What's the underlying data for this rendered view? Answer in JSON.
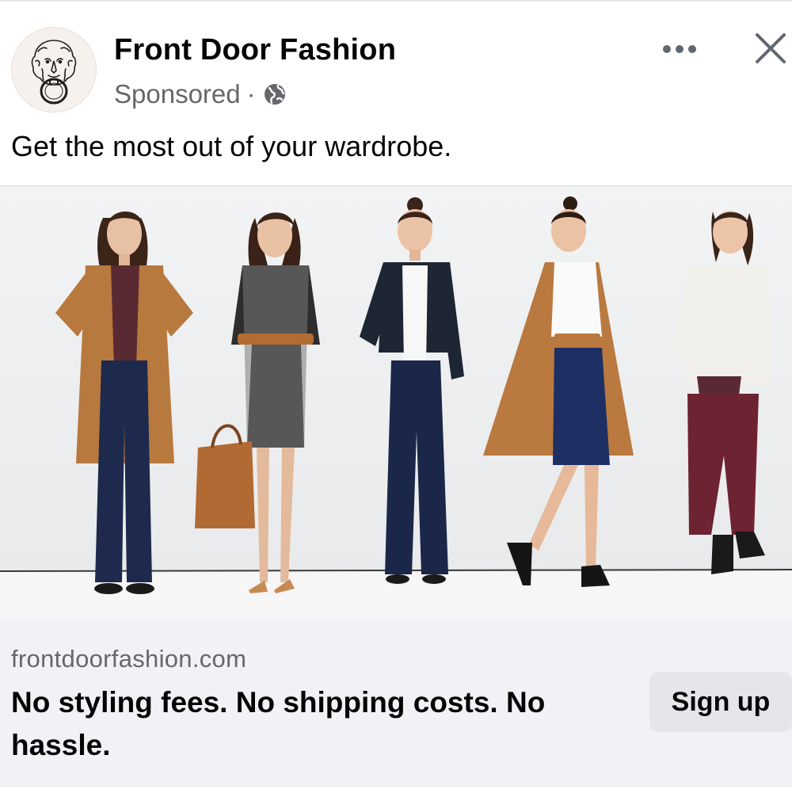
{
  "post": {
    "page_name": "Front Door Fashion",
    "sponsored_label": "Sponsored",
    "separator": "·",
    "audience_icon": "globe-icon",
    "more_icon": "more-horizontal-icon",
    "close_icon": "close-icon",
    "text": "Get the most out of your wardrobe."
  },
  "media": {
    "description_icon": "lion-door-knocker-logo",
    "models": [
      {
        "outfit": "camel suede duster, plaid shirt, flare jeans"
      },
      {
        "outfit": "geometric print wrap dress, belt, tote bag"
      },
      {
        "outfit": "leather moto jacket, white top, flare jeans"
      },
      {
        "outfit": "camel duster, white blouse, navy pencil skirt"
      },
      {
        "outfit": "cream sweater, plaid shirt, burgundy skinny jeans"
      }
    ]
  },
  "link": {
    "domain": "frontdoorfashion.com",
    "headline": "No styling fees. No shipping costs. No hassle.",
    "cta_label": "Sign up"
  },
  "colors": {
    "text_primary": "#050505",
    "text_secondary": "#65676b",
    "cta_background": "#e4e6eb",
    "link_bar_background": "#f0f2f5"
  }
}
